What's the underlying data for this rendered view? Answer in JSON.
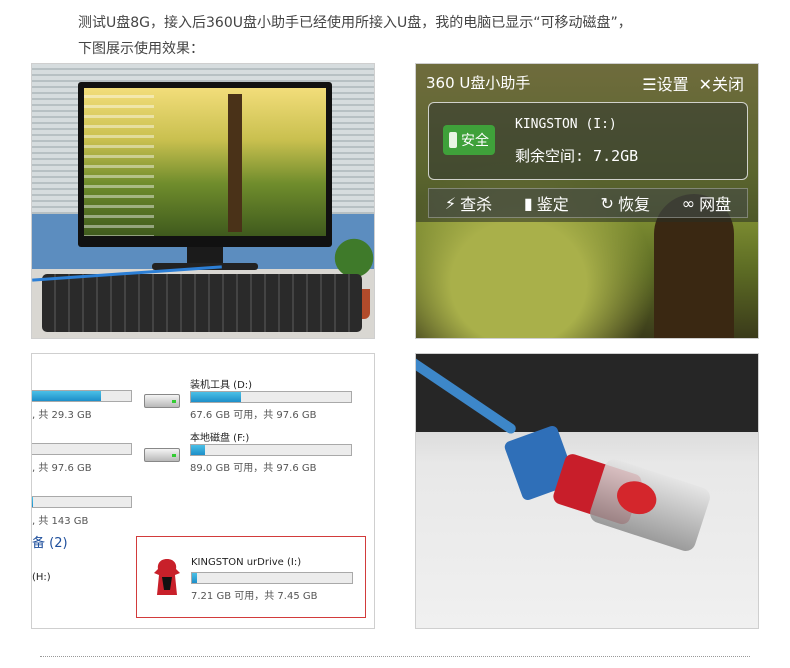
{
  "intro": {
    "line1": "测试U盘8G，接入后360U盘小助手已经使用所接入U盘，我的电脑已显示“可移动磁盘”，",
    "line2": "下图展示使用效果："
  },
  "assistant": {
    "title": "360 U盘小助手",
    "settings": "☰设置",
    "close": "✕关闭",
    "badge": "安全",
    "drive_name": "KINGSTON (I:)",
    "free_space": "剩余空间: 7.2GB",
    "tools": [
      "查杀",
      "鉴定",
      "恢复",
      "网盘"
    ],
    "tool_icons": [
      "bolt-icon",
      "usb-icon",
      "restore-icon",
      "cloud-icon"
    ]
  },
  "explorer": {
    "left_caps": [
      ", 共 29.3 GB",
      ", 共 97.6 GB",
      ", 共 143 GB"
    ],
    "left_fills": [
      0.7,
      0.0,
      0.02
    ],
    "drives": [
      {
        "name": "装机工具 (D:)",
        "cap": "67.6 GB 可用，共 97.6 GB",
        "used": 0.31
      },
      {
        "name": "本地磁盘 (F:)",
        "cap": "89.0 GB 可用，共 97.6 GB",
        "used": 0.09
      }
    ],
    "group_label": "备 (2)",
    "h_label": "(H:)",
    "usb": {
      "name": "KINGSTON urDrive (I:)",
      "cap": "7.21 GB 可用，共 7.45 GB",
      "used": 0.03
    }
  },
  "colors": {
    "bar_fill": "#1d8fc9",
    "highlight_border": "#d23b3b",
    "badge_green": "#3fa13a"
  }
}
